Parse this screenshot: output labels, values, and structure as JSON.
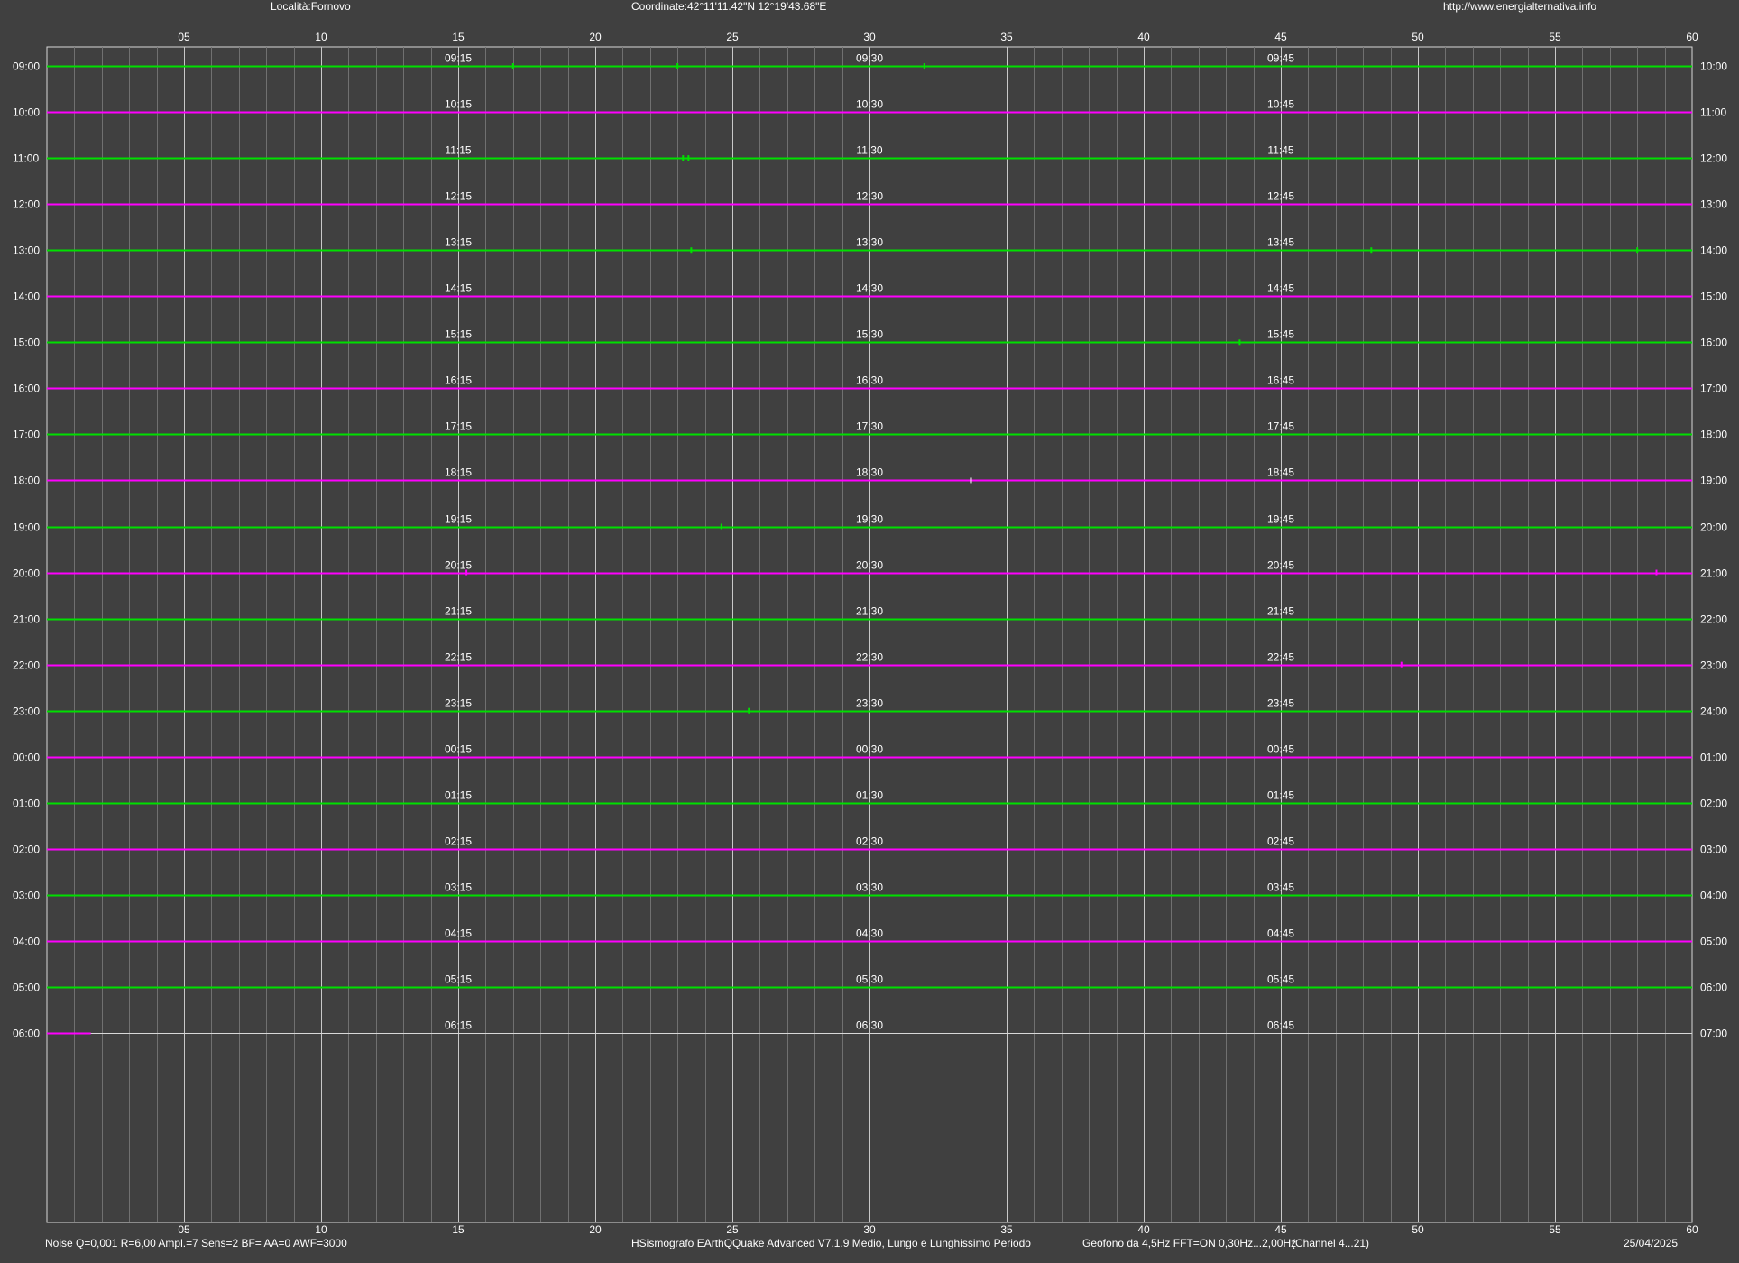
{
  "header": {
    "location": "Località:Fornovo",
    "coordinates": "Coordinate:42°11'11.42\"N  12°19'43.68\"E",
    "url": "http://www.energialternativa.info"
  },
  "footer": {
    "noise": "Noise Q=0,001 R=6,00 Ampl.=7 Sens=2 BF= AA=0 AWF=3000",
    "software": "HSismografo  EArthQQuake Advanced V7.1.9  Medio, Lungo e Lunghissimo Periodo",
    "geofono": "Geofono da 4,5Hz FFT=ON 0,30Hz...2,00Hz",
    "channel": "(Channel 4...21)",
    "date": "25/04/2025"
  },
  "chart_data": {
    "type": "line",
    "title": "",
    "xlabel": "",
    "ylabel": "",
    "xlim": [
      0,
      60
    ],
    "x_ticks": [
      "05",
      "10",
      "15",
      "20",
      "25",
      "30",
      "35",
      "40",
      "45",
      "50",
      "55",
      "60"
    ],
    "grid": true,
    "rows_left": [
      "09:00",
      "10:00",
      "11:00",
      "12:00",
      "13:00",
      "14:00",
      "15:00",
      "16:00",
      "17:00",
      "18:00",
      "19:00",
      "20:00",
      "21:00",
      "22:00",
      "23:00",
      "00:00",
      "01:00",
      "02:00",
      "03:00",
      "04:00",
      "05:00",
      "06:00"
    ],
    "rows_right": [
      "10:00",
      "11:00",
      "12:00",
      "13:00",
      "14:00",
      "15:00",
      "16:00",
      "17:00",
      "18:00",
      "19:00",
      "20:00",
      "21:00",
      "22:00",
      "23:00",
      "24:00",
      "01:00",
      "02:00",
      "03:00",
      "04:00",
      "05:00",
      "06:00",
      "07:00"
    ],
    "quarter_labels": [
      [
        "09:15",
        "09:30",
        "09:45"
      ],
      [
        "10:15",
        "10:30",
        "10:45"
      ],
      [
        "11:15",
        "11:30",
        "11:45"
      ],
      [
        "12:15",
        "12:30",
        "12:45"
      ],
      [
        "13:15",
        "13:30",
        "13:45"
      ],
      [
        "14:15",
        "14:30",
        "14:45"
      ],
      [
        "15:15",
        "15:30",
        "15:45"
      ],
      [
        "16:15",
        "16:30",
        "16:45"
      ],
      [
        "17:15",
        "17:30",
        "17:45"
      ],
      [
        "18:15",
        "18:30",
        "18:45"
      ],
      [
        "19:15",
        "19:30",
        "19:45"
      ],
      [
        "20:15",
        "20:30",
        "20:45"
      ],
      [
        "21:15",
        "21:30",
        "21:45"
      ],
      [
        "22:15",
        "22:30",
        "22:45"
      ],
      [
        "23:15",
        "23:30",
        "23:45"
      ],
      [
        "00:15",
        "00:30",
        "00:45"
      ],
      [
        "01:15",
        "01:30",
        "01:45"
      ],
      [
        "02:15",
        "02:30",
        "02:45"
      ],
      [
        "03:15",
        "03:30",
        "03:45"
      ],
      [
        "04:15",
        "04:30",
        "04:45"
      ],
      [
        "05:15",
        "05:30",
        "05:45"
      ],
      [
        "06:15",
        "06:30",
        "06:45"
      ]
    ],
    "trace_colors": [
      "#00e000",
      "#ff00ff"
    ],
    "last_row_trace_end_minute": 1.6,
    "events": [
      {
        "row": 0,
        "minute": 17.0
      },
      {
        "row": 0,
        "minute": 23.0
      },
      {
        "row": 0,
        "minute": 32.0
      },
      {
        "row": 2,
        "minute": 23.2
      },
      {
        "row": 2,
        "minute": 23.4
      },
      {
        "row": 4,
        "minute": 23.5
      },
      {
        "row": 4,
        "minute": 48.3
      },
      {
        "row": 4,
        "minute": 58.0
      },
      {
        "row": 6,
        "minute": 43.5
      },
      {
        "row": 9,
        "minute": 33.7
      },
      {
        "row": 10,
        "minute": 24.6
      },
      {
        "row": 11,
        "minute": 15.3
      },
      {
        "row": 11,
        "minute": 58.7
      },
      {
        "row": 13,
        "minute": 49.4
      },
      {
        "row": 14,
        "minute": 25.6
      }
    ]
  }
}
